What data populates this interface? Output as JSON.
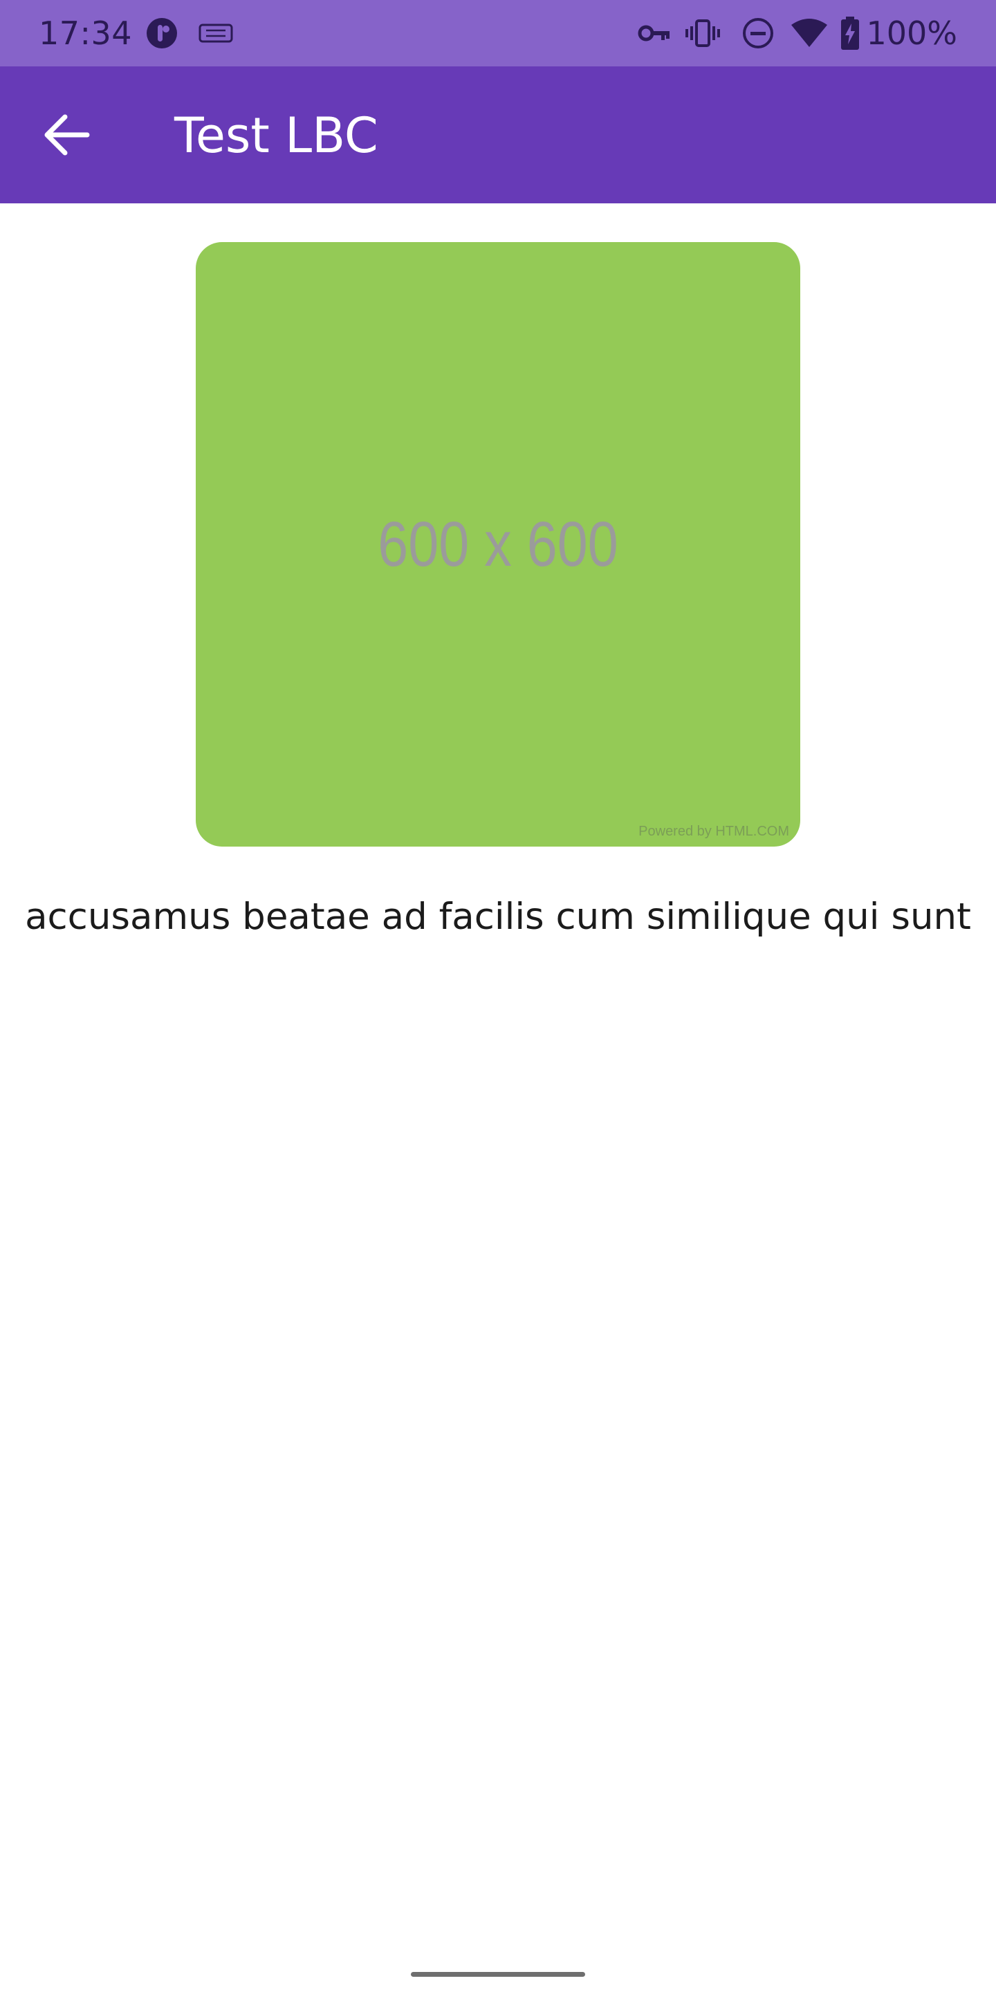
{
  "status_bar": {
    "time": "17:34",
    "battery_text": "100%",
    "background": "#8663c9",
    "icons": [
      "app-notification-icon",
      "keyboard-icon",
      "vpn-key-icon",
      "vibrate-icon",
      "do-not-disturb-icon",
      "wifi-icon",
      "battery-charging-icon"
    ]
  },
  "app_bar": {
    "title": "Test LBC",
    "background": "#673ab7",
    "back_icon": "arrow-back-icon"
  },
  "content": {
    "image": {
      "label": "600 x 600",
      "credit": "Powered by HTML.COM",
      "color": "#94ca56"
    },
    "caption": "accusamus beatae ad facilis cum similique qui sunt"
  }
}
